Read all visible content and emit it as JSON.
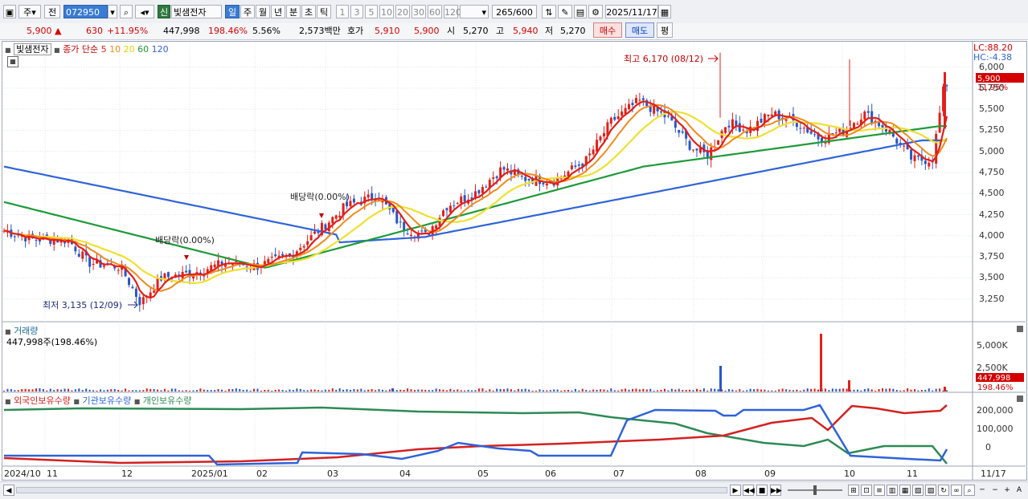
{
  "toolbar": {
    "period_label": "주",
    "prev_label": "전",
    "code": "072950",
    "credit_badge": "신",
    "stock_name": "빛샘전자",
    "tf": [
      "일",
      "주",
      "월",
      "년",
      "분",
      "초",
      "틱"
    ],
    "nums": [
      "1",
      "3",
      "5",
      "10",
      "20",
      "30",
      "60",
      "120"
    ],
    "count": "265",
    "total": "/600",
    "date": "2025/11/17"
  },
  "info": {
    "price": "5,900",
    "arrow": "▲",
    "change": "630",
    "change_pct": "+11.95%",
    "volume": "447,998",
    "vol_pct": "198.46%",
    "turnover": "5.56%",
    "amount": "2,573백만",
    "quote_label": "호가",
    "ask": "5,910",
    "bid": "5,900",
    "open_label": "시",
    "open": "5,270",
    "high_label": "고",
    "high": "5,940",
    "low_label": "저",
    "low": "5,270",
    "buy": "매수",
    "sell": "매도",
    "avg": "평"
  },
  "price_panel": {
    "name": "빛샘전자",
    "legend_prefix": "종가 단순",
    "ma": [
      {
        "label": "5",
        "color": "#e0201a"
      },
      {
        "label": "10",
        "color": "#f08a1c"
      },
      {
        "label": "20",
        "color": "#f0e030"
      },
      {
        "label": "60",
        "color": "#1e9a3a"
      },
      {
        "label": "120",
        "color": "#2f63d8"
      }
    ],
    "lc": "LC:88.20",
    "hc": "HC:-4.38",
    "cur_price": "5,900",
    "cur_pct": "11.95%",
    "hi_note": "최고 6,170 (08/12)",
    "lo_note": "최저 3,135 (12/09)",
    "div1": "배당락(0.00%)",
    "div2": "배당락(0.00%)",
    "yticks": [
      "6,000",
      "5,750",
      "5,500",
      "5,250",
      "5,000",
      "4,750",
      "4,500",
      "4,250",
      "4,000",
      "3,750",
      "3,500",
      "3,250"
    ]
  },
  "volume_panel": {
    "title": "거래량",
    "value": "447,998주(198.46%)",
    "yticks": [
      "5,000K",
      "2,500K"
    ],
    "cur": "447,998",
    "cur_pct": "198.46%"
  },
  "holding_panel": {
    "legend": [
      {
        "label": "외국인보유수량",
        "color": "#d42020"
      },
      {
        "label": "기관보유수량",
        "color": "#2f63d8"
      },
      {
        "label": "개인보유수량",
        "color": "#2e8a55"
      }
    ],
    "yticks": [
      "200,000",
      "100,000",
      "0"
    ]
  },
  "xaxis": [
    "2024/10",
    "11",
    "12",
    "2025/01",
    "02",
    "03",
    "04",
    "05",
    "06",
    "07",
    "08",
    "09",
    "10",
    "11"
  ],
  "xaxis_end": "11/17"
}
